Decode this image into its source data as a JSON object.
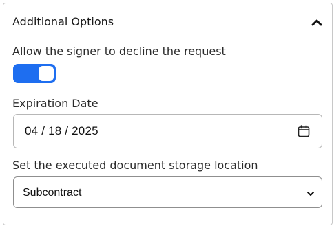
{
  "panel": {
    "title": "Additional Options",
    "collapse_icon": "chevron-up-icon"
  },
  "decline": {
    "label": "Allow the signer to decline the request",
    "enabled": true,
    "accent_color": "#1e6ef0"
  },
  "expiration": {
    "label": "Expiration Date",
    "value": "04 / 18 / 2025",
    "icon": "calendar-icon"
  },
  "storage": {
    "label": "Set the executed document storage location",
    "selected": "Subcontract",
    "icon": "chevron-down-icon"
  }
}
